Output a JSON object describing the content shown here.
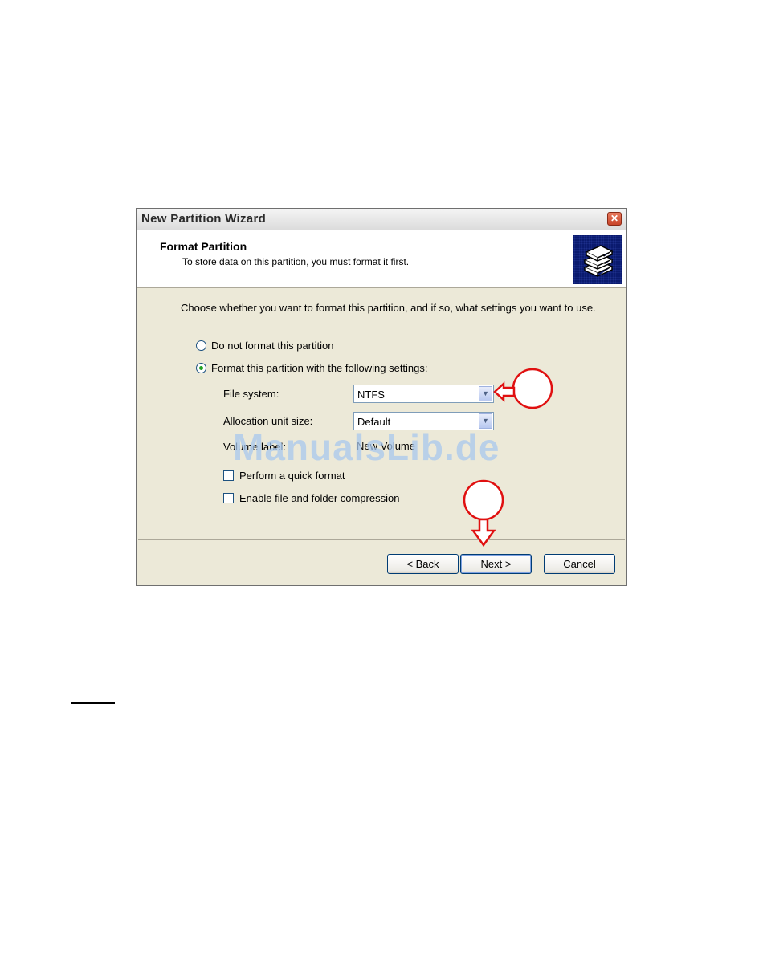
{
  "window": {
    "title": "New Partition Wizard",
    "close_glyph": "✕"
  },
  "header": {
    "title": "Format Partition",
    "subtitle": "To store data on this partition, you must format it first.",
    "icon": "format-disks-icon"
  },
  "intro": "Choose whether you want to format this partition, and if so, what settings you want to use.",
  "options": {
    "no_format": {
      "label": "Do not format this partition",
      "selected": false
    },
    "format": {
      "label": "Format this partition with the following settings:",
      "selected": true
    }
  },
  "fields": {
    "file_system": {
      "label": "File system:",
      "value": "NTFS"
    },
    "allocation": {
      "label": "Allocation unit size:",
      "value": "Default"
    },
    "volume_label": {
      "label": "Volume label:",
      "value": "New Volume"
    }
  },
  "checkboxes": {
    "quick_format": {
      "label": "Perform a quick format",
      "checked": false
    },
    "compression": {
      "label": "Enable file and folder compression",
      "checked": false
    }
  },
  "buttons": {
    "back": "< Back",
    "next": "Next >",
    "cancel": "Cancel"
  },
  "watermark": "ManualsLib.de",
  "annotation_color": "#e01010"
}
